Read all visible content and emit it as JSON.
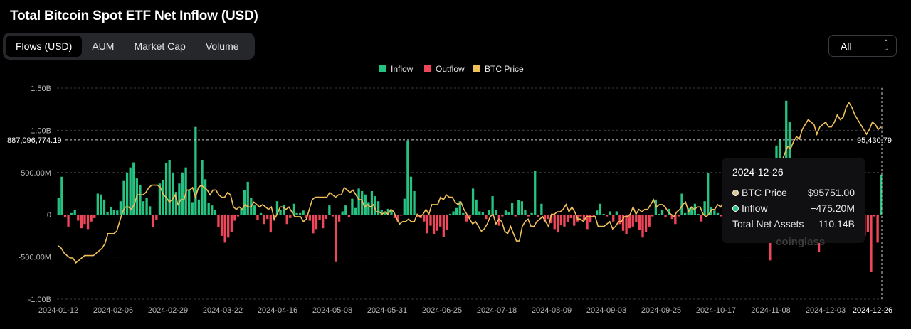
{
  "title": "Total Bitcoin Spot ETF Net Inflow (USD)",
  "tabs": [
    {
      "label": "Flows (USD)",
      "active": true
    },
    {
      "label": "AUM",
      "active": false
    },
    {
      "label": "Market Cap",
      "active": false
    },
    {
      "label": "Volume",
      "active": false
    }
  ],
  "range_select": {
    "value": "All",
    "icon": "chevron-updown-icon"
  },
  "legend": [
    {
      "label": "Inflow",
      "color": "#26c281"
    },
    {
      "label": "Outflow",
      "color": "#f0465a"
    },
    {
      "label": "BTC Price",
      "color": "#f0c05a"
    }
  ],
  "crosshair": {
    "left_label": "887,096,774.19",
    "right_label": "95,430.79"
  },
  "tooltip": {
    "date": "2024-12-26",
    "rows": [
      {
        "label": "BTC Price",
        "value": "$95751.00",
        "color": "#d8c48c"
      },
      {
        "label": "Inflow",
        "value": "+475.20M",
        "color": "#26c281"
      },
      {
        "label": "Total Net Assets",
        "value": "110.14B"
      }
    ]
  },
  "watermark": "coinglass",
  "chart_data": {
    "type": "bar",
    "title": "Total Bitcoin Spot ETF Net Inflow (USD)",
    "ylim": [
      -1000000000,
      1500000000
    ],
    "y_ticks": [
      "1.50B",
      "1.00B",
      "500.00M",
      "0",
      "-500.00M",
      "-1.00B"
    ],
    "x_ticks": [
      "2024-01-12",
      "2024-02-06",
      "2024-02-29",
      "2024-03-22",
      "2024-04-16",
      "2024-05-08",
      "2024-05-31",
      "2024-06-25",
      "2024-07-18",
      "2024-08-09",
      "2024-09-03",
      "2024-09-25",
      "2024-10-17",
      "2024-11-08",
      "2024-12-03",
      "2024-12-26"
    ],
    "series": [
      {
        "name": "Inflow",
        "color": "#26c281"
      },
      {
        "name": "Outflow",
        "color": "#f0465a"
      },
      {
        "name": "BTC Price",
        "color": "#f0c05a"
      }
    ],
    "flows_musd": [
      200,
      450,
      -30,
      -140,
      20,
      60,
      -70,
      -160,
      -110,
      -170,
      -80,
      -40,
      250,
      240,
      180,
      30,
      90,
      60,
      50,
      160,
      400,
      500,
      560,
      620,
      430,
      350,
      160,
      200,
      100,
      -150,
      -60,
      370,
      410,
      610,
      650,
      490,
      270,
      370,
      500,
      560,
      290,
      150,
      1040,
      180,
      650,
      420,
      140,
      110,
      60,
      -150,
      -250,
      -330,
      -270,
      -200,
      -70,
      -20,
      70,
      290,
      390,
      200,
      110,
      -60,
      20,
      -110,
      -50,
      -210,
      -70,
      160,
      60,
      120,
      -110,
      -40,
      130,
      20,
      20,
      50,
      -40,
      -70,
      -220,
      -170,
      -60,
      -160,
      -50,
      110,
      -20,
      -560,
      -80,
      40,
      110,
      -30,
      190,
      80,
      310,
      280,
      240,
      150,
      280,
      220,
      160,
      60,
      20,
      70,
      60,
      -40,
      -80,
      -10,
      190,
      880,
      450,
      280,
      -30,
      -40,
      -80,
      -220,
      -130,
      -230,
      -190,
      -140,
      -260,
      -180,
      10,
      40,
      80,
      160,
      20,
      -80,
      -40,
      310,
      180,
      40,
      30,
      -50,
      60,
      220,
      60,
      -130,
      -20,
      50,
      30,
      140,
      -20,
      170,
      160,
      60,
      -20,
      20,
      520,
      -30,
      130,
      -80,
      -50,
      -100,
      -170,
      -210,
      -120,
      -140,
      -90,
      -40,
      -130,
      -80,
      -20,
      -60,
      -170,
      -90,
      -20,
      50,
      130,
      10,
      -20,
      40,
      -80,
      40,
      -110,
      -190,
      -230,
      -160,
      -140,
      -90,
      -180,
      -270,
      -200,
      -140,
      -20,
      180,
      10,
      60,
      -30,
      70,
      -50,
      -110,
      -20,
      250,
      20,
      80,
      90,
      130,
      10,
      -80,
      160,
      490,
      90,
      50,
      20,
      -20,
      -60,
      -20,
      140,
      300,
      40,
      120,
      320,
      550,
      370,
      260,
      490,
      -20,
      -60,
      -300,
      -540,
      -100,
      820,
      900,
      -20,
      1350,
      1100,
      60,
      -20,
      -120,
      50,
      160,
      40,
      250,
      250,
      -440,
      20,
      -10,
      -20,
      -200,
      -40,
      -320,
      -50,
      30,
      40,
      400,
      450,
      -230,
      -150,
      -250,
      -200,
      -680,
      -20,
      -330,
      475
    ],
    "price_k": [
      47,
      46,
      44,
      43,
      42,
      42,
      40,
      41,
      42,
      43,
      43,
      43,
      43,
      44,
      45,
      46,
      48,
      52,
      52,
      52,
      53,
      57,
      61,
      63,
      63,
      62,
      64,
      68,
      68,
      68,
      69,
      71,
      72,
      72,
      72,
      71,
      68,
      67,
      65,
      66,
      68,
      64,
      66,
      66,
      70,
      70,
      71,
      67,
      71,
      72,
      71,
      70,
      68,
      70,
      70,
      68,
      67,
      67,
      69,
      68,
      63,
      62,
      63,
      62,
      64,
      63,
      63,
      65,
      64,
      63,
      64,
      63,
      62,
      63,
      58,
      60,
      63,
      63,
      62,
      63,
      61,
      59,
      59,
      59,
      57,
      58,
      62,
      66,
      67,
      67,
      67,
      67,
      67,
      69,
      68,
      67,
      68,
      68,
      71,
      70,
      69,
      70,
      68,
      66,
      66,
      63,
      64,
      63,
      64,
      61,
      61,
      60,
      61,
      60,
      62,
      61,
      58,
      56,
      57,
      57,
      58,
      57,
      57,
      60,
      59,
      60,
      62,
      60,
      64,
      64,
      64,
      67,
      66,
      68,
      67,
      67,
      65,
      64,
      65,
      62,
      60,
      58,
      56,
      57,
      55,
      53,
      54,
      56,
      59,
      60,
      56,
      58,
      57,
      53,
      52,
      55,
      52,
      49,
      49,
      55,
      57,
      58,
      55,
      55,
      57,
      58,
      59,
      57,
      55,
      60,
      60,
      61,
      61,
      62,
      64,
      61,
      63,
      61,
      58,
      58,
      57,
      59,
      59,
      59,
      59,
      55,
      55,
      55,
      56,
      57,
      54,
      55,
      57,
      57,
      59,
      59,
      60,
      63,
      60,
      62,
      61,
      62,
      62,
      64,
      66,
      63,
      64,
      64,
      63,
      61,
      60,
      59,
      61,
      62,
      64,
      65,
      61,
      63,
      62,
      63,
      63,
      60,
      59,
      60,
      62,
      62,
      64,
      63,
      65,
      68,
      68,
      69,
      68,
      68,
      68,
      67,
      68,
      69,
      70,
      72,
      73,
      71,
      72,
      72,
      69,
      68,
      76,
      81,
      82,
      85,
      88,
      87,
      90,
      92,
      91,
      95,
      97,
      99,
      98,
      97,
      93,
      96,
      97,
      98,
      96,
      96,
      98,
      101,
      99,
      100,
      104,
      106,
      104,
      101,
      99,
      97,
      95,
      93,
      95,
      98,
      97,
      95,
      96
    ]
  }
}
